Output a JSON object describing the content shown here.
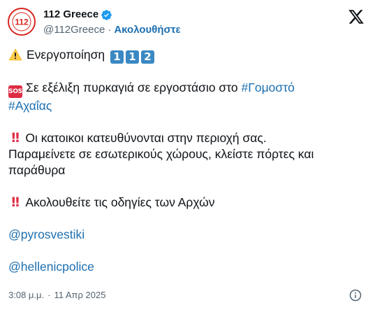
{
  "author": {
    "display_name": "112 Greece",
    "handle": "@112Greece",
    "separator": "·",
    "follow_label": "Ακολουθήστε",
    "avatar_text": "112"
  },
  "tweet": {
    "line1_text": "Ενεργοποίηση",
    "keycaps": [
      "1",
      "1",
      "2"
    ],
    "sos_label": "SOS",
    "line2_text": "Σε εξέλιξη πυρκαγιά σε εργοστάσιο στο ",
    "hashtag1": "#Γομοστό",
    "hashtag2": "#Αχαΐας",
    "bang_glyph": "!!",
    "line3_text": "Οι κατοικοι κατευθύνονται στην περιοχή σας.",
    "line4_text": "Παραμείνετε σε εσωτερικούς χώρους, κλείστε πόρτες και",
    "line5_text": "παράθυρα",
    "line6_text": "Ακολουθείτε τις οδηγίες των Αρχών",
    "mention1": "@pyrosvestiki",
    "mention2": "@hellenicpolice"
  },
  "footer": {
    "time": "3:08 μ.μ.",
    "separator": "·",
    "date": "11 Απρ 2025"
  },
  "colors": {
    "link": "#1d6fb0",
    "text": "#0f1419",
    "muted": "#536471",
    "keycap": "#3b88c3",
    "alert_red": "#dd2e44",
    "avatar_red": "#d7261e"
  }
}
